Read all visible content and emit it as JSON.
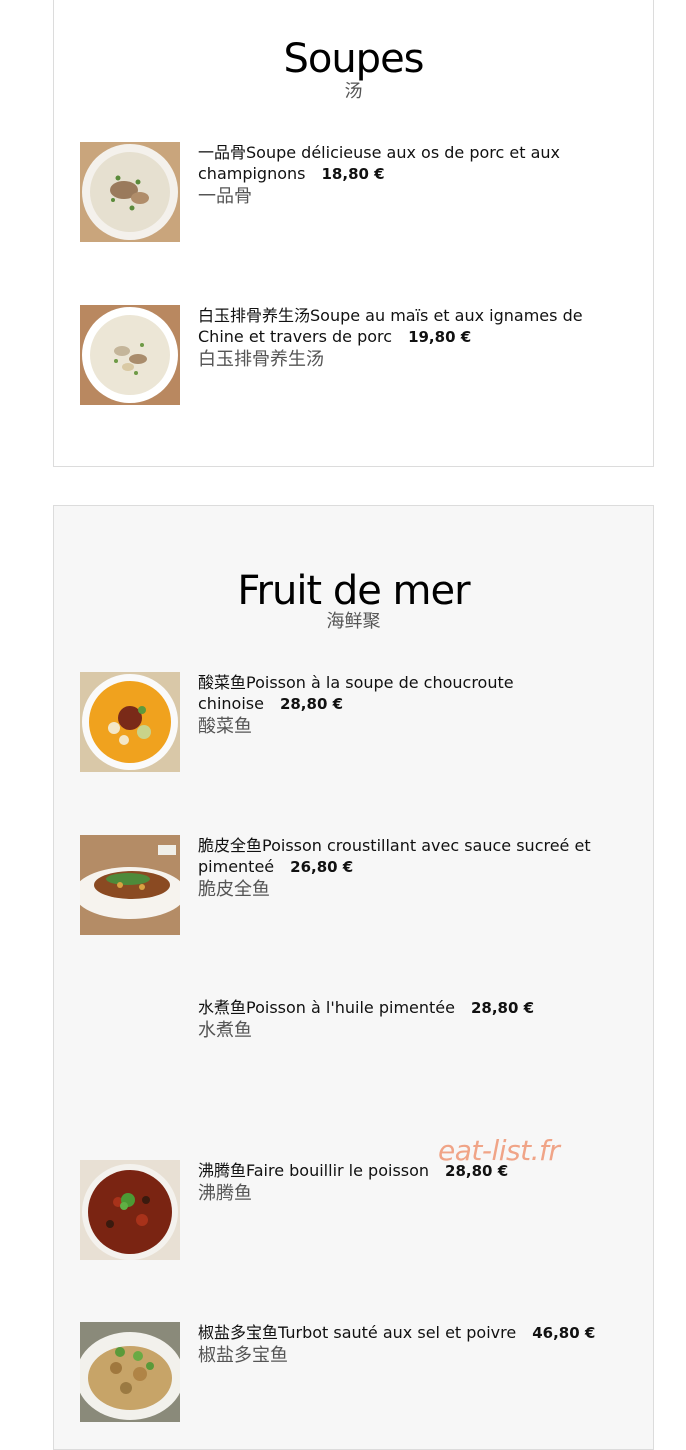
{
  "soupes": {
    "title": "Soupes",
    "subtitle": "汤",
    "items": [
      {
        "name": "一品骨Soupe délicieuse aux os de porc et aux champignons",
        "price": "18,80 €",
        "zh": "一品骨",
        "image": "pork-bone-soup-photo"
      },
      {
        "name": "白玉排骨养生汤Soupe au maïs et aux ignames de Chine et travers de porc",
        "price": "19,80 €",
        "zh": "白玉排骨养生汤",
        "image": "yam-rib-soup-photo"
      }
    ]
  },
  "fruit_de_mer": {
    "title": "Fruit de mer",
    "subtitle": "海鲜聚",
    "items": [
      {
        "name": "酸菜鱼Poisson à la soupe de choucroute chinoise",
        "price": "28,80 €",
        "zh": "酸菜鱼",
        "image": "sauerkraut-fish-photo"
      },
      {
        "name": "脆皮全鱼Poisson croustillant avec sauce sucreé et pimenteé",
        "price": "26,80 €",
        "zh": "脆皮全鱼",
        "image": "crispy-fish-photo"
      },
      {
        "name": "水煮鱼Poisson à l'huile pimentée",
        "price": "28,80 €",
        "zh": "水煮鱼",
        "image": ""
      },
      {
        "name": "沸腾鱼Faire bouillir le poisson",
        "price": "28,80 €",
        "zh": "沸腾鱼",
        "image": "boiling-fish-photo"
      },
      {
        "name": "椒盐多宝鱼Turbot sauté aux sel et poivre",
        "price": "46,80 €",
        "zh": "椒盐多宝鱼",
        "image": "turbot-photo"
      }
    ]
  },
  "watermark": "eat-list.fr",
  "colors": {
    "watermark": "#f0a487",
    "section_alt_bg": "#f7f7f7",
    "border": "#dcdcdc"
  }
}
